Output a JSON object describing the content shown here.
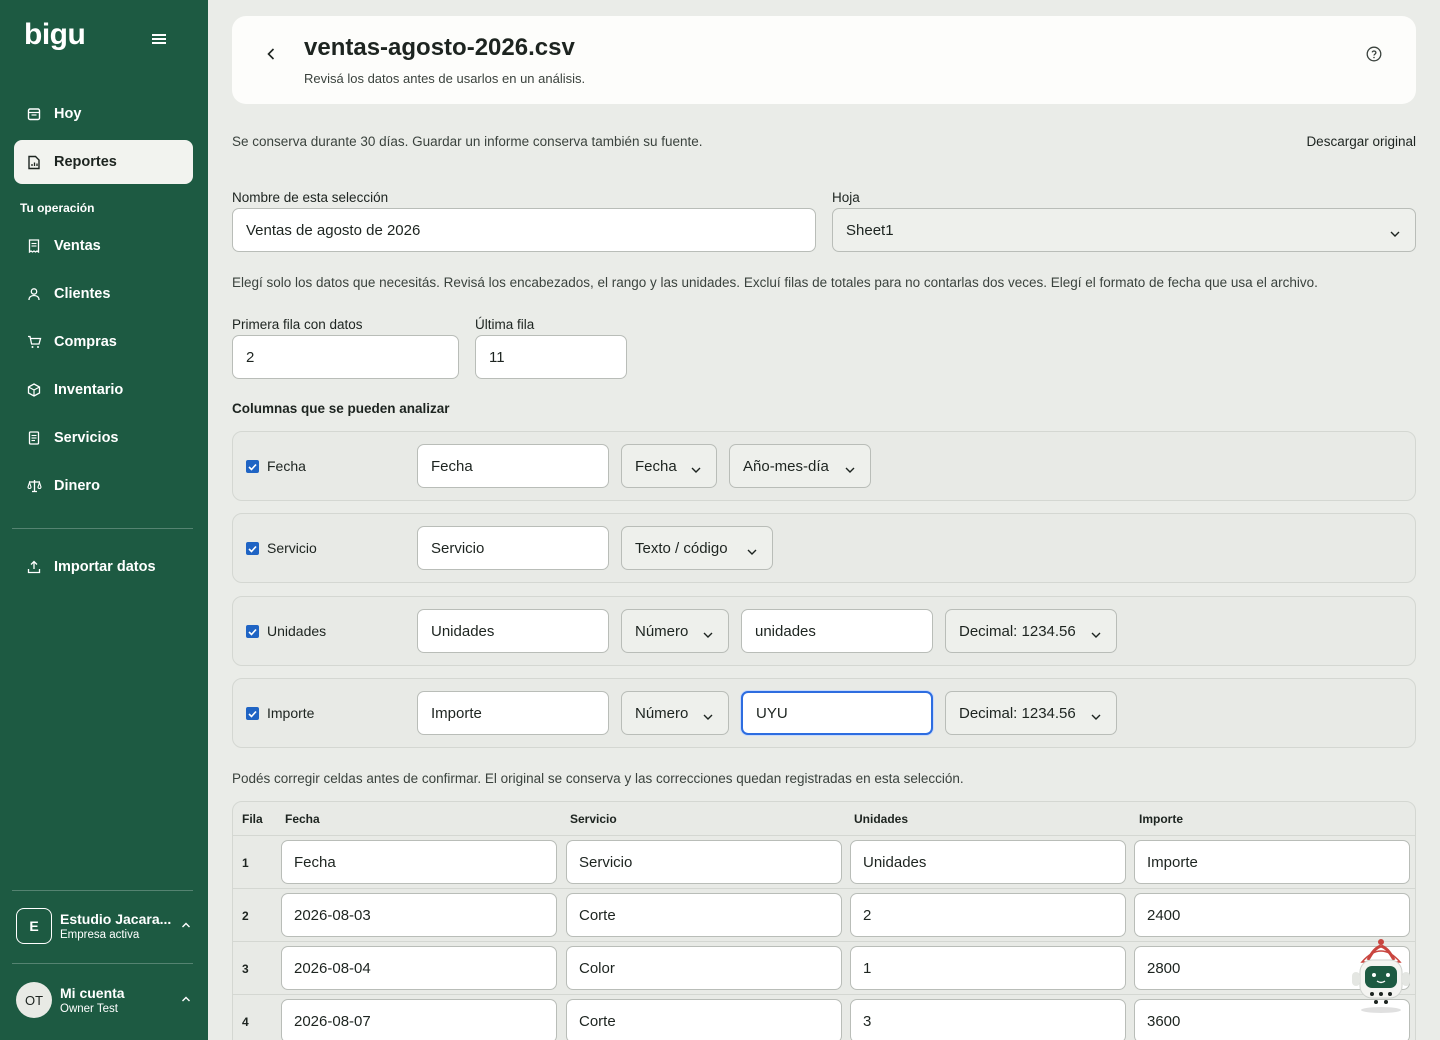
{
  "sidebar": {
    "brand": "bigu",
    "nav_top": [
      {
        "label": "Hoy",
        "icon": "calendar-icon"
      },
      {
        "label": "Reportes",
        "icon": "report-icon",
        "active": true
      }
    ],
    "section_label": "Tu operación",
    "nav_ops": [
      {
        "label": "Ventas",
        "icon": "receipt-icon"
      },
      {
        "label": "Clientes",
        "icon": "user-icon"
      },
      {
        "label": "Compras",
        "icon": "cart-icon"
      },
      {
        "label": "Inventario",
        "icon": "box-icon"
      },
      {
        "label": "Servicios",
        "icon": "document-icon"
      },
      {
        "label": "Dinero",
        "icon": "scale-icon"
      }
    ],
    "import_label": "Importar datos",
    "company": {
      "initial": "E",
      "name": "Estudio Jacara...",
      "status": "Empresa activa"
    },
    "account": {
      "initials": "OT",
      "name": "Mi cuenta",
      "user": "Owner Test"
    }
  },
  "header": {
    "title": "ventas-agosto-2026.csv",
    "subtitle": "Revisá los datos antes de usarlos en un análisis."
  },
  "retention_text": "Se conserva durante 30 días. Guardar un informe conserva también su fuente.",
  "download_label": "Descargar original",
  "selection": {
    "name_label": "Nombre de esta selección",
    "name_value": "Ventas de agosto de 2026",
    "sheet_label": "Hoja",
    "sheet_value": "Sheet1"
  },
  "instructions": "Elegí solo los datos que necesitás. Revisá los encabezados, el rango y las unidades. Excluí filas de totales para no contarlas dos veces. Elegí el formato de fecha que usa el archivo.",
  "range": {
    "first_label": "Primera fila con datos",
    "first_value": "2",
    "last_label": "Última fila",
    "last_value": "11"
  },
  "columns_title": "Columnas que se pueden analizar",
  "columns": [
    {
      "name": "Fecha",
      "header": "Fecha",
      "type": "Fecha",
      "format": "Año-mes-día"
    },
    {
      "name": "Servicio",
      "header": "Servicio",
      "type": "Texto / código"
    },
    {
      "name": "Unidades",
      "header": "Unidades",
      "type": "Número",
      "unit": "unidades",
      "decimal": "Decimal: 1234.56"
    },
    {
      "name": "Importe",
      "header": "Importe",
      "type": "Número",
      "unit": "UYU",
      "decimal": "Decimal: 1234.56"
    }
  ],
  "correction_note": "Podés corregir celdas antes de confirmar. El original se conserva y las correcciones quedan registradas en esta selección.",
  "table": {
    "headers": [
      "Fila",
      "Fecha",
      "Servicio",
      "Unidades",
      "Importe"
    ],
    "rows": [
      {
        "n": "1",
        "cells": [
          "Fecha",
          "Servicio",
          "Unidades",
          "Importe"
        ]
      },
      {
        "n": "2",
        "cells": [
          "2026-08-03",
          "Corte",
          "2",
          "2400"
        ]
      },
      {
        "n": "3",
        "cells": [
          "2026-08-04",
          "Color",
          "1",
          "2800"
        ]
      },
      {
        "n": "4",
        "cells": [
          "2026-08-07",
          "Corte",
          "3",
          "3600"
        ]
      }
    ]
  },
  "colors": {
    "sidebar": "#1d5a42",
    "accent": "#1f64c4"
  }
}
